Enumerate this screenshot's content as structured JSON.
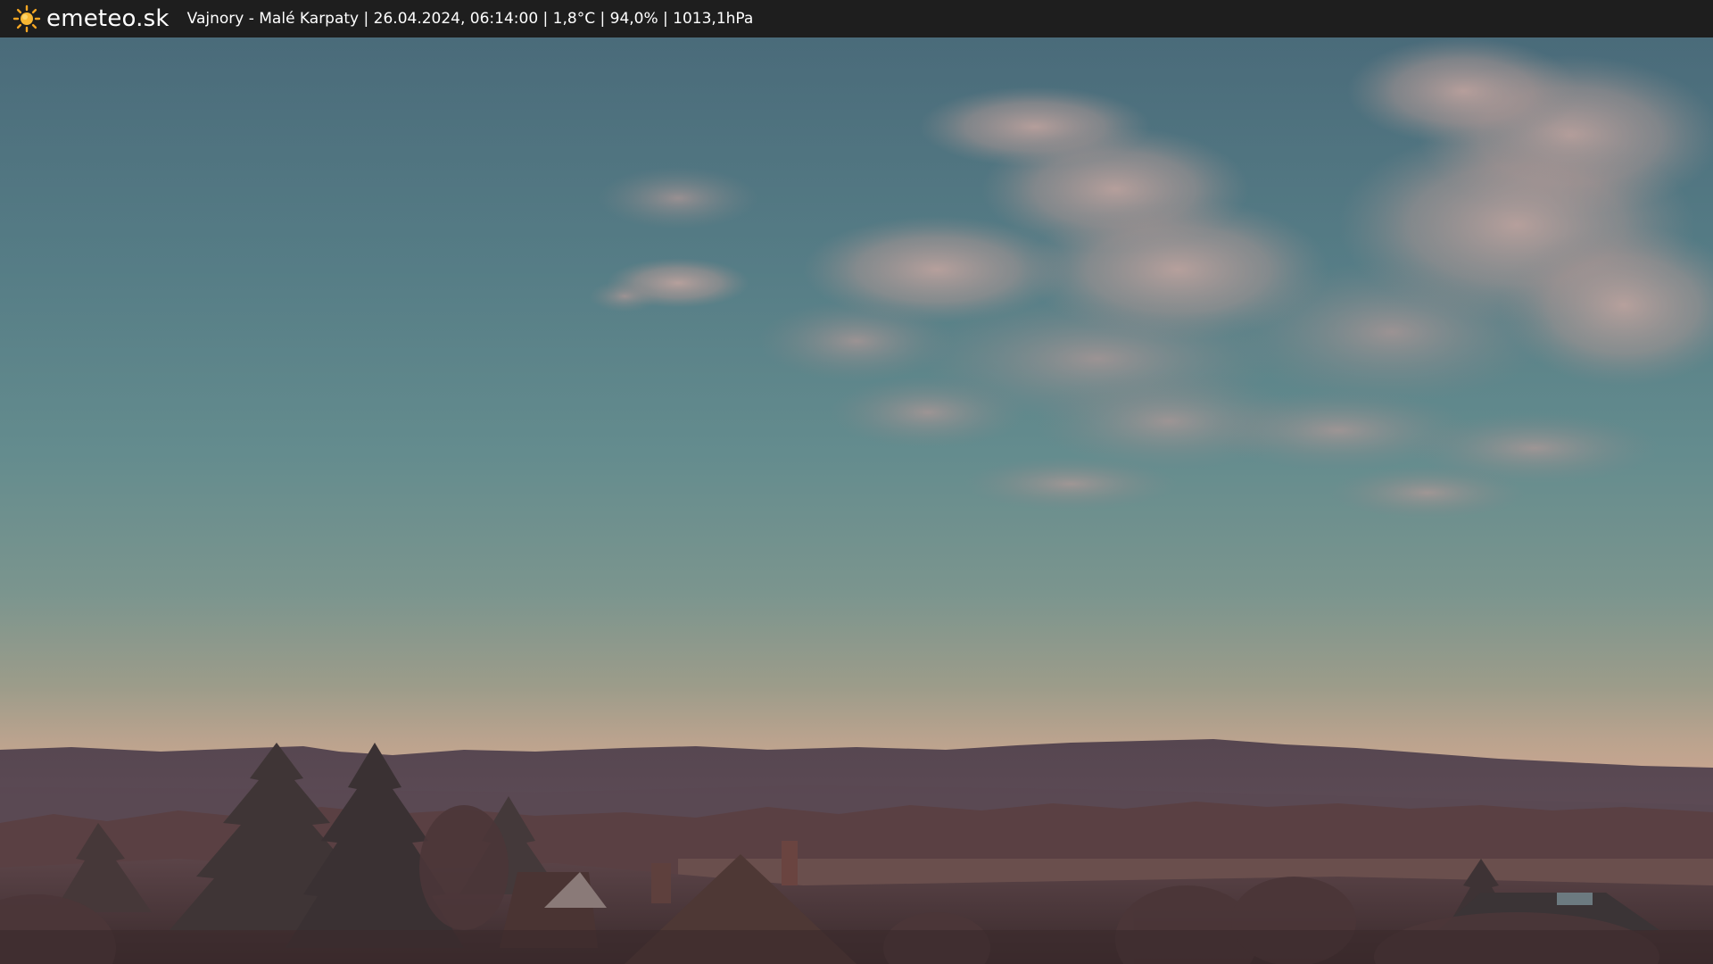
{
  "header": {
    "brand_name": "emeteo.sk",
    "caption": "Vajnory - Malé Karpaty | 26.04.2024, 06:14:00 | 1,8°C | 94,0% | 1013,1hPa",
    "brand_icon": "sun-icon",
    "background_color": "#1e1e1e",
    "icon_color": "#f5a623"
  },
  "webcam": {
    "sky_top_color": "#4a6f7c",
    "sky_mid_color": "#6d8f90",
    "horizon_color": "#c8a48e",
    "hills_color": "#4d3f48",
    "foreground_color": "#3e2c2e"
  }
}
